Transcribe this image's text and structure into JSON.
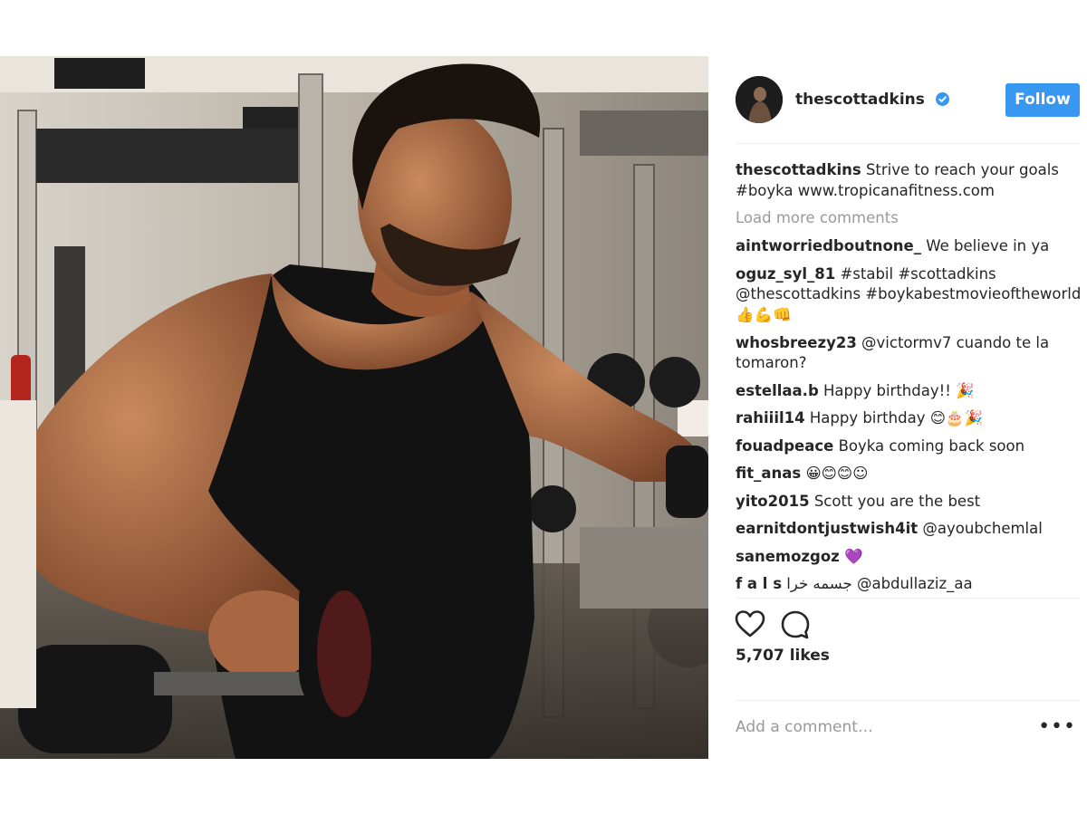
{
  "post": {
    "username": "thescottadkins",
    "verified_icon": "verified-badge-icon",
    "follow_label": "Follow",
    "caption": {
      "user": "thescottadkins",
      "text": "Strive to reach your goals #boyka www.tropicanafitness.com"
    },
    "load_more_label": "Load more comments",
    "comments": [
      {
        "user": "aintworriedboutnone_",
        "text": "We believe in ya"
      },
      {
        "user": "oguz_syl_81",
        "text": "#stabil #scottadkins @thescottadkins #boykabestmovieoftheworld👍💪👊"
      },
      {
        "user": "whosbreezy23",
        "text": "@victormv7 cuando te la tomaron?"
      },
      {
        "user": "estellaa.b",
        "text": "Happy birthday!! 🎉"
      },
      {
        "user": "rahiiil14",
        "text": "Happy birthday 😊🎂🎉"
      },
      {
        "user": "fouadpeace",
        "text": "Boyka coming back soon"
      },
      {
        "user": "fit_anas",
        "text": "😀😊😊☺"
      },
      {
        "user": "yito2015",
        "text": "Scott you are the best"
      },
      {
        "user": "earnitdontjustwish4it",
        "text": "@ayoubchemlal"
      },
      {
        "user": "sanemozgoz",
        "text": "💜"
      },
      {
        "user": "f a l s",
        "text": "جسمه خرا @abdullaziz_aa"
      }
    ],
    "likes": "5,707 likes",
    "add_comment_placeholder": "Add a comment…",
    "more_label": "•••",
    "icons": {
      "like": "heart-icon",
      "comment": "comment-bubble-icon"
    },
    "colors": {
      "follow_button": "#3897f0",
      "muted_text": "#999999",
      "text": "#262626"
    }
  }
}
